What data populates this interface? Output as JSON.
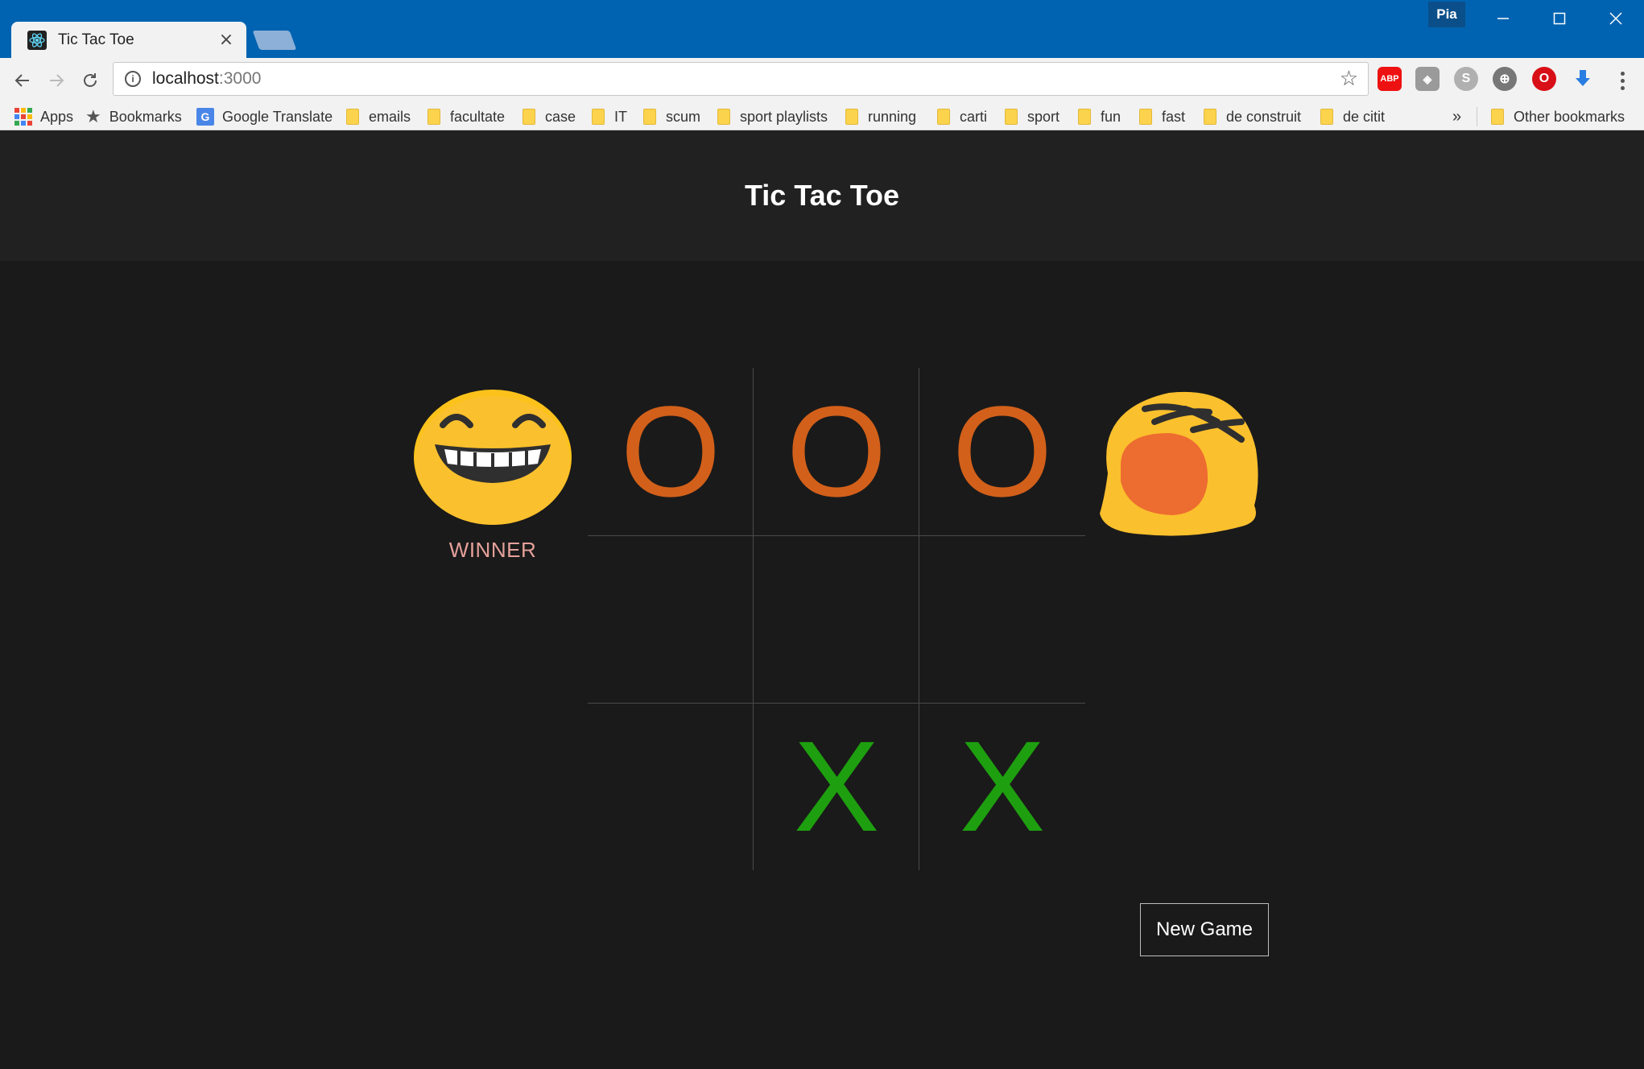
{
  "browser": {
    "tab_title": "Tic Tac Toe",
    "profile_name": "Pia",
    "url_host": "localhost",
    "url_port": ":3000",
    "extensions": [
      "adblock-icon",
      "evernote-icon",
      "skype-icon",
      "globe-icon",
      "opera-icon",
      "download-icon"
    ],
    "bookmarks": [
      {
        "label": "Apps",
        "icon": "apps-icon"
      },
      {
        "label": "Bookmarks",
        "icon": "star-icon"
      },
      {
        "label": "Google Translate",
        "icon": "google-translate-icon"
      },
      {
        "label": "emails",
        "icon": "folder-icon"
      },
      {
        "label": "facultate",
        "icon": "folder-icon"
      },
      {
        "label": "case",
        "icon": "folder-icon"
      },
      {
        "label": "IT",
        "icon": "folder-icon"
      },
      {
        "label": "scum",
        "icon": "folder-icon"
      },
      {
        "label": "sport playlists",
        "icon": "folder-icon"
      },
      {
        "label": "running",
        "icon": "folder-icon"
      },
      {
        "label": "carti",
        "icon": "folder-icon"
      },
      {
        "label": "sport",
        "icon": "folder-icon"
      },
      {
        "label": "fun",
        "icon": "folder-icon"
      },
      {
        "label": "fast",
        "icon": "folder-icon"
      },
      {
        "label": "de construit",
        "icon": "folder-icon"
      },
      {
        "label": "de citit",
        "icon": "folder-icon"
      }
    ],
    "overflow_label": "»",
    "other_bookmarks": "Other bookmarks"
  },
  "game": {
    "title": "Tic Tac Toe",
    "board": [
      "O",
      "O",
      "O",
      "",
      "",
      "",
      "",
      "X",
      "X"
    ],
    "left_player": {
      "avatar": "laughing-emoji-icon",
      "status": "WINNER"
    },
    "right_player": {
      "avatar": "crying-emoji-icon",
      "status": ""
    },
    "new_game_label": "New Game",
    "colors": {
      "o": "#d2601a",
      "x": "#1e9f0f",
      "winner_text": "#e4a09a"
    }
  }
}
